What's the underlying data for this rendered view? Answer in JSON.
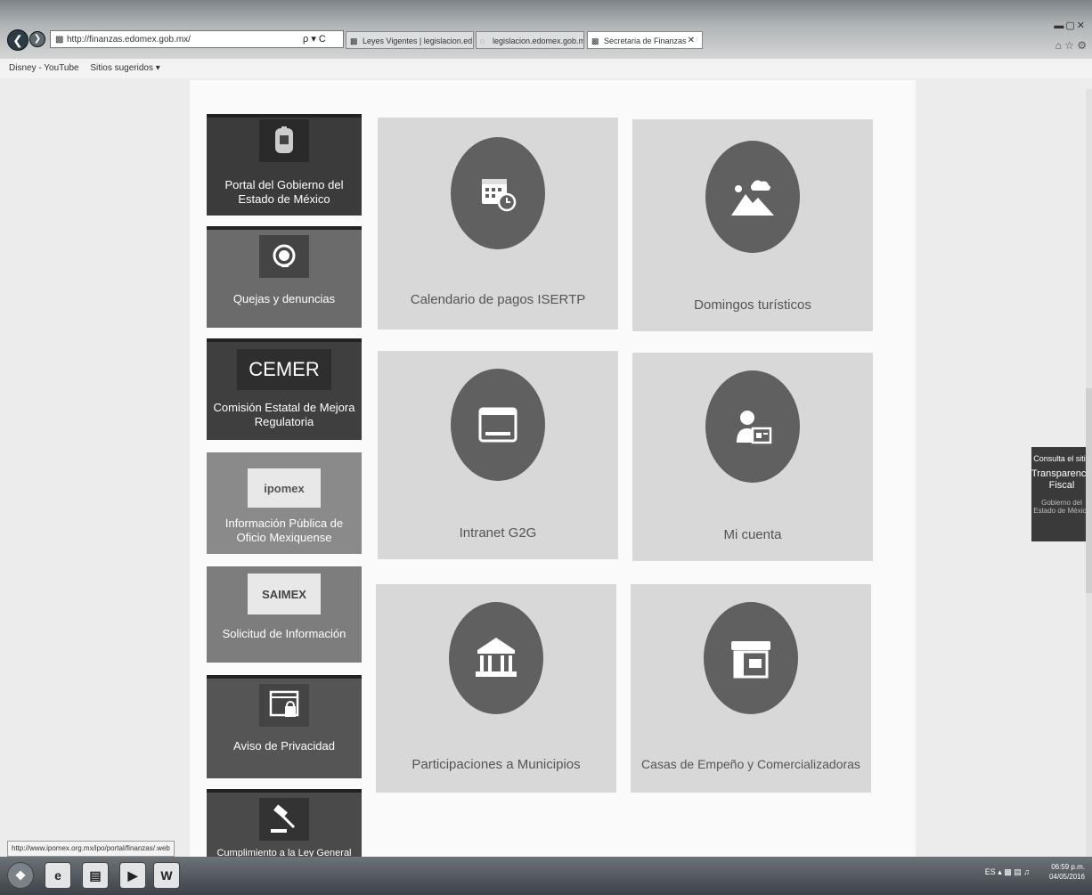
{
  "browser": {
    "address": "http://finanzas.edomex.gob.mx/",
    "address_tools": "ρ ▾ C",
    "tabs": [
      {
        "label": "Leyes Vigentes | legislacion.ed..."
      },
      {
        "label": "legislacion.edomex.gob.mx"
      },
      {
        "label": "Secretaria de Finanzas",
        "active": true
      }
    ],
    "favorites": [
      "Disney - YouTube",
      "Sitios sugeridos ▾"
    ]
  },
  "sidebar": {
    "items": [
      {
        "label": "Portal del Gobierno del Estado de México",
        "color": "#3b3b3b",
        "icon": "state-seal-icon"
      },
      {
        "label": "Quejas y denuncias",
        "color": "#6b6b6b",
        "icon": "headset-icon"
      },
      {
        "label": "Comisión Estatal de Mejora Regulatoria",
        "logo": "CEMER",
        "color": "#3f3f3f"
      },
      {
        "label": "Información Pública de Oficio Mexiquense",
        "logo": "ipomex",
        "color": "#8a8a8a"
      },
      {
        "label": "Solicitud de Información",
        "logo": "SAIMEX",
        "color": "#7d7d7d"
      },
      {
        "label": "Aviso de Privacidad",
        "color": "#555555",
        "icon": "privacy-lock-icon"
      },
      {
        "label": "Cumplimiento a la Ley General",
        "color": "#4a4a4a",
        "icon": "gavel-icon"
      }
    ]
  },
  "tiles": [
    {
      "label": "Calendario de pagos ISERTP",
      "icon": "calendar-clock-icon"
    },
    {
      "label": "Domingos turísticos",
      "icon": "landscape-icon"
    },
    {
      "label": "Intranet G2G",
      "icon": "browser-window-icon"
    },
    {
      "label": "Mi cuenta",
      "icon": "user-card-icon"
    },
    {
      "label": "Participaciones a Municipios",
      "icon": "kiosk-icon"
    },
    {
      "label": "Casas de Empeño y Comercializadoras",
      "icon": "storefront-icon"
    }
  ],
  "side_tab": {
    "line1": "Consulta el sitio",
    "line2": "Transparencia Fiscal",
    "line3": "Gobierno del Estado de México"
  },
  "status_url": "http://www.ipomex.org.mx/ipo/portal/finanzas/.web",
  "taskbar": {
    "lang": "ES",
    "time": "06:59 p.m.",
    "date": "04/05/2016"
  }
}
